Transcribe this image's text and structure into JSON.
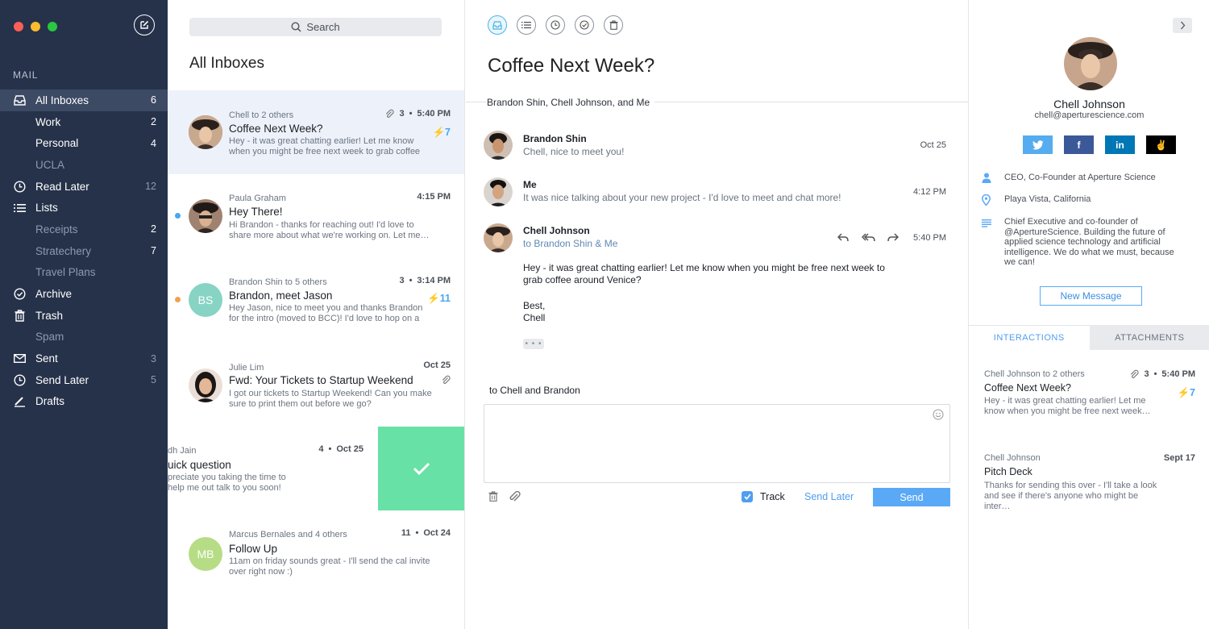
{
  "colors": {
    "sidebar_bg": "#26324a",
    "accent_blue": "#5aa9f6",
    "swipe_green": "#67e1a6",
    "twitter": "#55acee",
    "facebook": "#3b5998",
    "linkedin": "#0077b5",
    "dot_blue": "#4aa6ef",
    "dot_orange": "#f0a14f"
  },
  "sidebar": {
    "section_label": "MAIL",
    "items": [
      {
        "label": "All Inboxes",
        "count": "6",
        "icon": "inbox-icon"
      },
      {
        "label": "Work",
        "count": "2"
      },
      {
        "label": "Personal",
        "count": "4"
      },
      {
        "label": "UCLA",
        "count": ""
      },
      {
        "label": "Read Later",
        "count": "12",
        "icon": "clock-icon"
      },
      {
        "label": "Lists",
        "count": "",
        "icon": "list-icon"
      },
      {
        "label": "Receipts",
        "count": "2"
      },
      {
        "label": "Stratechery",
        "count": "7"
      },
      {
        "label": "Travel Plans",
        "count": ""
      },
      {
        "label": "Archive",
        "count": "",
        "icon": "check-circle-icon"
      },
      {
        "label": "Trash",
        "count": "",
        "icon": "trash-icon"
      },
      {
        "label": "Spam",
        "count": ""
      },
      {
        "label": "Sent",
        "count": "3",
        "icon": "envelope-icon"
      },
      {
        "label": "Send Later",
        "count": "5",
        "icon": "clock-icon"
      },
      {
        "label": "Drafts",
        "count": "",
        "icon": "pencil-icon"
      }
    ]
  },
  "message_list": {
    "search_placeholder": "Search",
    "title": "All Inboxes",
    "messages": [
      {
        "from": "Chell to 2 others",
        "subject": "Coffee Next Week?",
        "preview": "Hey - it was great chatting earlier! Let me know when you might be free next week to grab coffee",
        "count": "3",
        "time": "5:40 PM",
        "bolt": "⚡7"
      },
      {
        "from": "Paula Graham",
        "subject": "Hey There!",
        "preview": "Hi Brandon - thanks for reaching out! I'd love to share more about what we're working on. Let me…",
        "count": "",
        "time": "4:15 PM",
        "bolt": ""
      },
      {
        "from": "Brandon Shin to 5 others",
        "subject": "Brandon, meet Jason",
        "preview": "Hey Jason, nice to meet you and thanks Brandon for the intro (moved to BCC)! I'd love to hop on a",
        "count": "3",
        "time": "3:14 PM",
        "bolt": "⚡11",
        "initials": "BS"
      },
      {
        "from": "Julie Lim",
        "subject": "Fwd: Your Tickets to Startup Weekend",
        "preview": "I got our tickets to Startup Weekend! Can you make sure to print them out before we go?",
        "count": "",
        "time": "Oct 25",
        "bolt": ""
      },
      {
        "from": "dh Jain",
        "subject": "uick question",
        "preview": "preciate you taking the time to help me out talk to you soon!",
        "count": "4",
        "time": "Oct 25",
        "bolt": ""
      },
      {
        "from": "Marcus Bernales and 4 others",
        "subject": "Follow Up",
        "preview": "11am on friday sounds great - I'll send the cal invite over right now :)",
        "count": "11",
        "time": "Oct 24",
        "bolt": "",
        "initials": "MB"
      }
    ]
  },
  "thread": {
    "subject": "Coffee Next Week?",
    "participants": "Brandon Shin, Chell Johnson, and Me",
    "messages": [
      {
        "name": "Brandon Shin",
        "snippet": "Chell, nice to meet you!",
        "date": "Oct 25"
      },
      {
        "name": "Me",
        "snippet": "It was nice talking about your new project - I'd love to meet and chat more!",
        "date": "4:12 PM"
      },
      {
        "name": "Chell Johnson",
        "to": "to Brandon Shin & Me",
        "date": "5:40 PM",
        "body1": "Hey - it was great chatting earlier! Let me know when you might be free next week to grab coffee around Venice?",
        "body2": "Best,",
        "body3": "Chell"
      }
    ],
    "reply_to": "to Chell and Brandon",
    "track_label": "Track",
    "send_later_label": "Send Later",
    "send_label": "Send",
    "ellipsis": "• • •"
  },
  "contact": {
    "name": "Chell Johnson",
    "email": "chell@aperturescience.com",
    "title": "CEO, Co-Founder at Aperture Science",
    "location": "Playa Vista, California",
    "bio": "Chief Executive and co-founder of @ApertureScience. Building the future of applied science technology and artificial intelligence. We do what we must, because we can!",
    "new_message_label": "New Message",
    "tab_interactions": "INTERACTIONS",
    "tab_attachments": "ATTACHMENTS",
    "socials": {
      "twitter": "twitter-icon",
      "facebook": "f",
      "linkedin": "in",
      "angellist": "✌"
    },
    "interactions": [
      {
        "from": "Chell Johnson to 2 others",
        "subject": "Coffee Next Week?",
        "preview": "Hey - it was great chatting earlier! Let me know when you might be free next week…",
        "count": "3",
        "time": "5:40 PM",
        "bolt": "⚡7"
      },
      {
        "from": "Chell Johnson",
        "subject": "Pitch Deck",
        "preview": "Thanks for sending this over - I'll take a look and see if there's anyone who might be inter…",
        "count": "",
        "time": "Sept 17",
        "bolt": ""
      }
    ]
  }
}
